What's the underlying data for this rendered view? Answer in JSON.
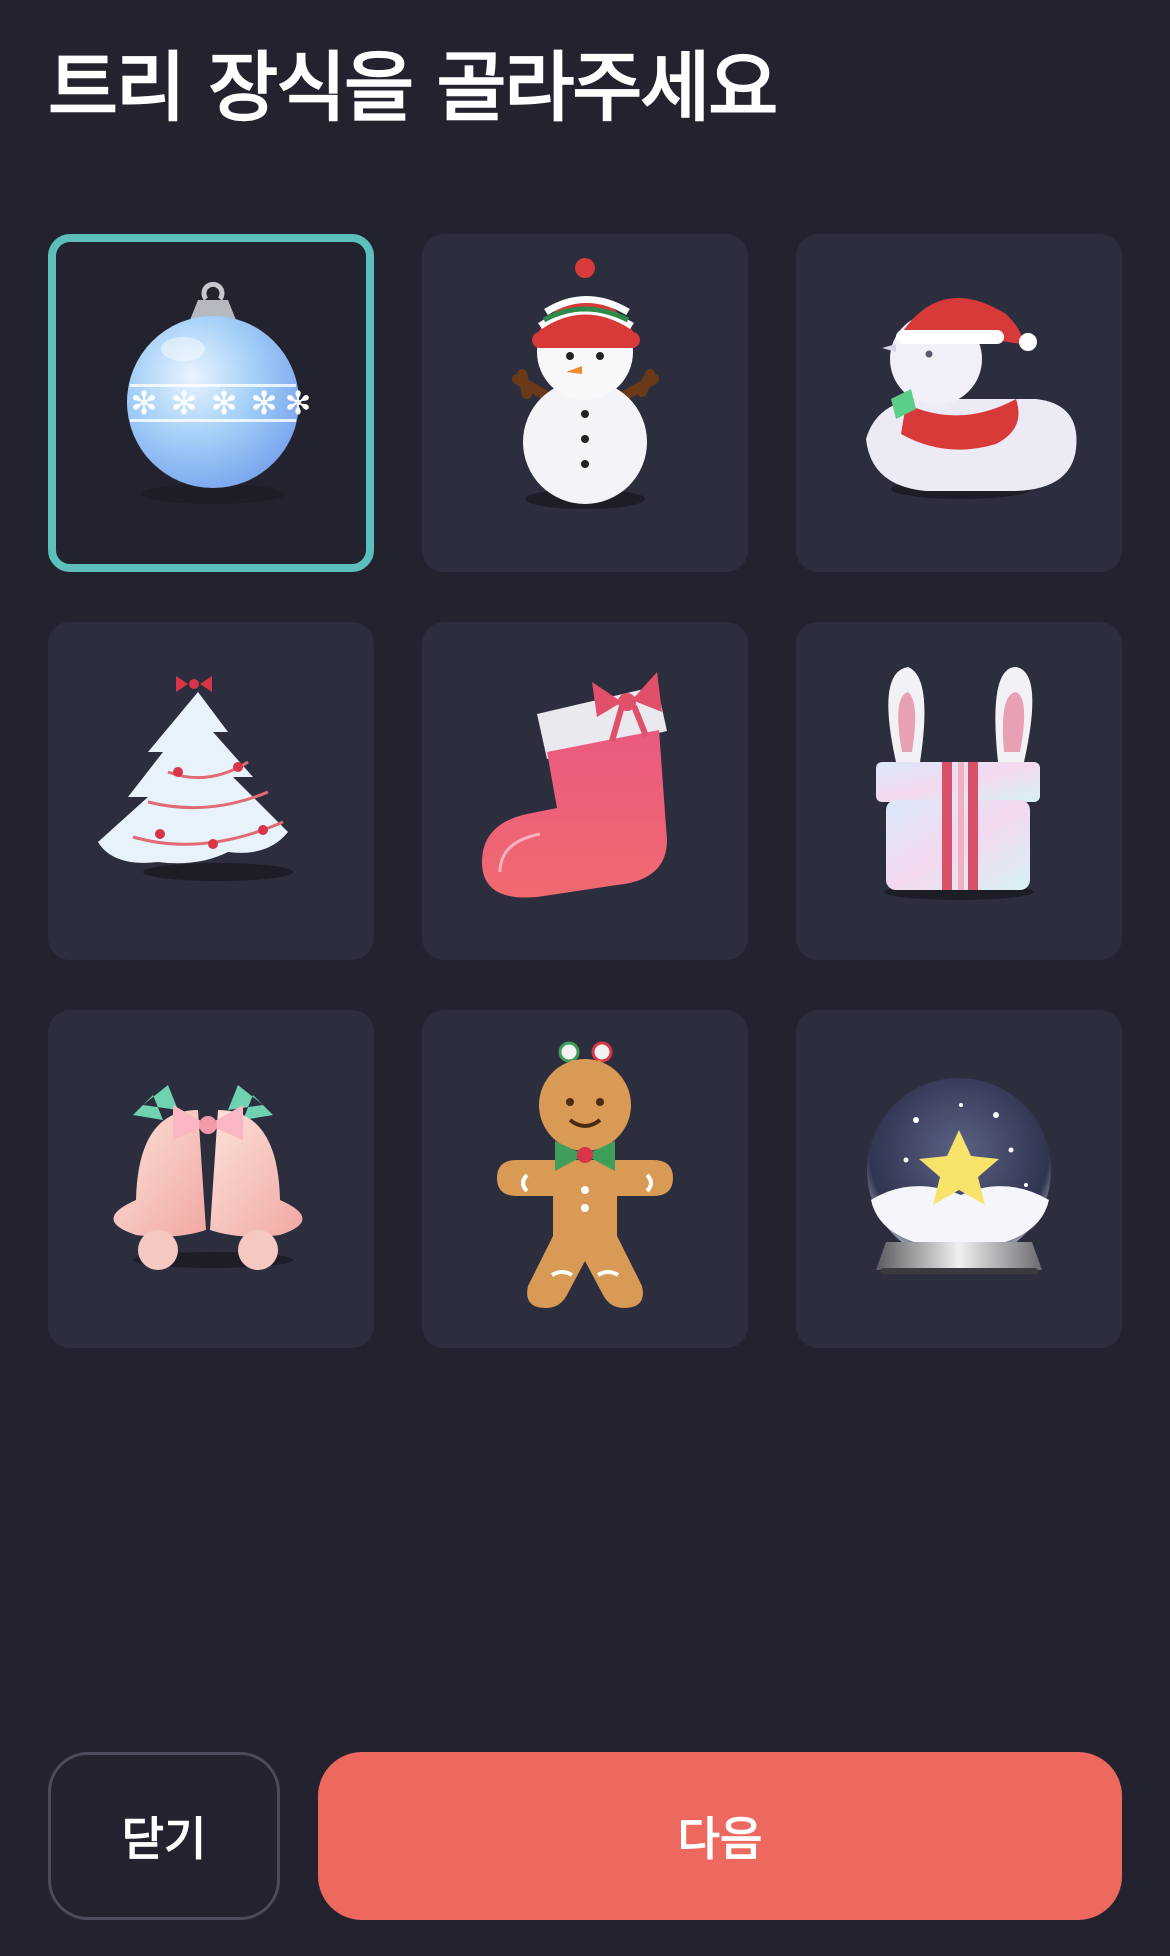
{
  "header": {
    "title": "트리 장식을 골라주세요"
  },
  "ornaments": {
    "selected_index": 0,
    "items": [
      {
        "icon": "ornament-ball-icon"
      },
      {
        "icon": "snowman-icon"
      },
      {
        "icon": "santa-duck-icon"
      },
      {
        "icon": "snowy-tree-icon"
      },
      {
        "icon": "stocking-icon"
      },
      {
        "icon": "bunny-gift-box-icon"
      },
      {
        "icon": "bells-icon"
      },
      {
        "icon": "gingerbread-man-icon"
      },
      {
        "icon": "snow-globe-icon"
      }
    ]
  },
  "footer": {
    "close_label": "닫기",
    "next_label": "다음"
  },
  "colors": {
    "background": "#22232f",
    "tile": "#2c2e3e",
    "selected_border": "#5cbfbb",
    "next_button": "#ed685e"
  }
}
